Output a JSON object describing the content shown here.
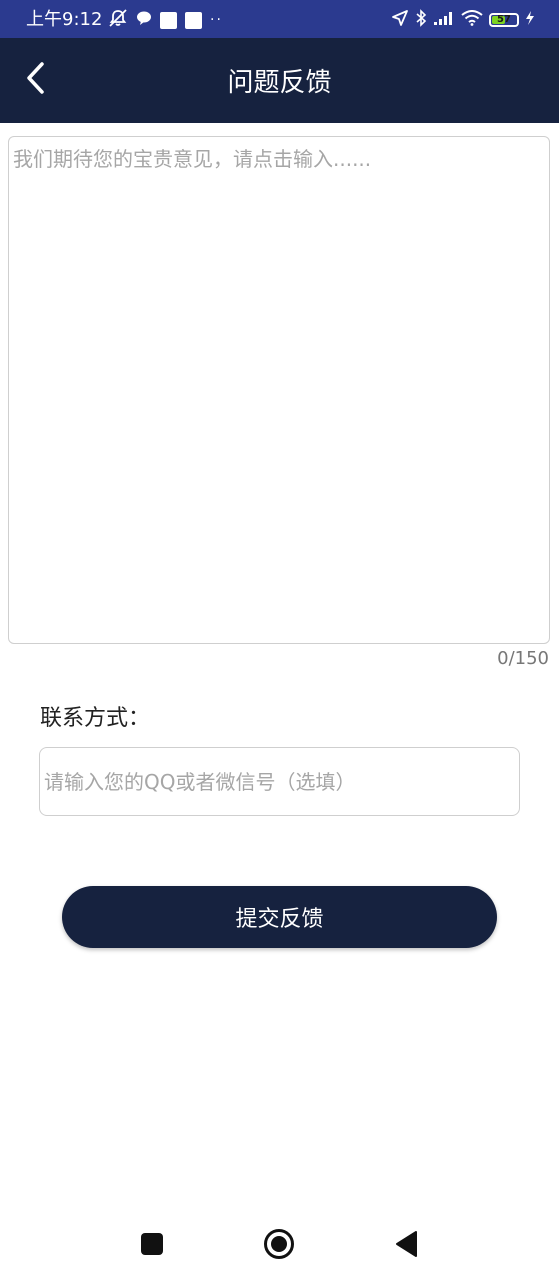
{
  "status_bar": {
    "time": "上午9:12",
    "battery_level": "57",
    "battery_percent": 57,
    "battery_color": "#7ed321",
    "background": "#2b3a8f",
    "left_icons": [
      "bell-off-icon",
      "chat-bubble-icon",
      "notification-square-icon",
      "notification-square-icon",
      "more-dots-icon"
    ],
    "right_icons": [
      "location-arrow-icon",
      "bluetooth-icon",
      "signal-icon",
      "wifi-icon",
      "battery-icon",
      "charging-bolt-icon"
    ]
  },
  "header": {
    "title": "问题反馈",
    "back_icon": "chevron-left-icon",
    "background": "#16223f"
  },
  "feedback": {
    "placeholder": "我们期待您的宝贵意见，请点击输入......",
    "value": "",
    "counter": "0/150"
  },
  "contact": {
    "label": "联系方式：",
    "placeholder": "请输入您的QQ或者微信号（选填）",
    "value": ""
  },
  "submit": {
    "label": "提交反馈"
  },
  "nav_bar": {
    "items": [
      "recents-square-icon",
      "home-circle-icon",
      "back-triangle-icon"
    ]
  }
}
